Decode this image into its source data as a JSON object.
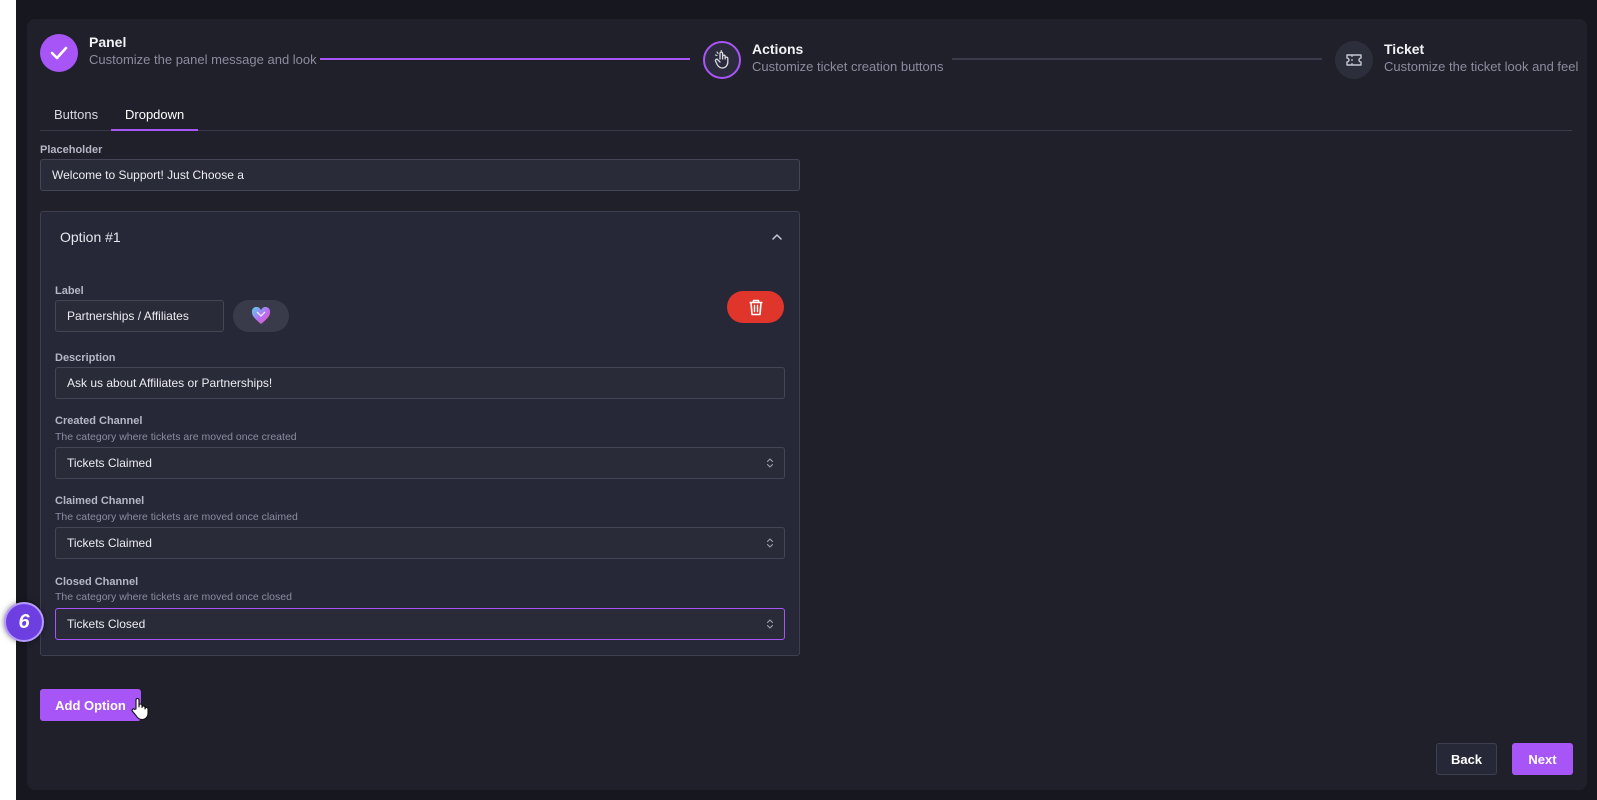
{
  "stepper": {
    "steps": [
      {
        "title": "Panel",
        "subtitle": "Customize the panel message and look",
        "state": "done",
        "icon": "check-icon"
      },
      {
        "title": "Actions",
        "subtitle": "Customize ticket creation buttons",
        "state": "active",
        "icon": "pointer-hand-icon"
      },
      {
        "title": "Ticket",
        "subtitle": "Customize the ticket look and feel",
        "state": "todo",
        "icon": "ticket-icon"
      }
    ]
  },
  "tabs": [
    {
      "label": "Buttons",
      "active": false
    },
    {
      "label": "Dropdown",
      "active": true
    }
  ],
  "placeholder": {
    "label": "Placeholder",
    "value": "Welcome to Support! Just Choose a"
  },
  "option": {
    "title": "Option #1",
    "label_field": {
      "label": "Label",
      "value": "Partnerships / Affiliates"
    },
    "emoji": "heart-emoji",
    "description": {
      "label": "Description",
      "value": "Ask us about Affiliates or Partnerships!"
    },
    "created_channel": {
      "label": "Created Channel",
      "hint": "The category where tickets are moved once created",
      "value": "Tickets Claimed"
    },
    "claimed_channel": {
      "label": "Claimed Channel",
      "hint": "The category where tickets are moved once claimed",
      "value": "Tickets Claimed"
    },
    "closed_channel": {
      "label": "Closed Channel",
      "hint": "The category where tickets are moved once closed",
      "value": "Tickets Closed"
    }
  },
  "buttons": {
    "add_option": "Add Option",
    "back": "Back",
    "next": "Next"
  },
  "step_badge": "6",
  "colors": {
    "accent": "#a855f7",
    "danger": "#e0352b",
    "background": "#1f2029"
  }
}
